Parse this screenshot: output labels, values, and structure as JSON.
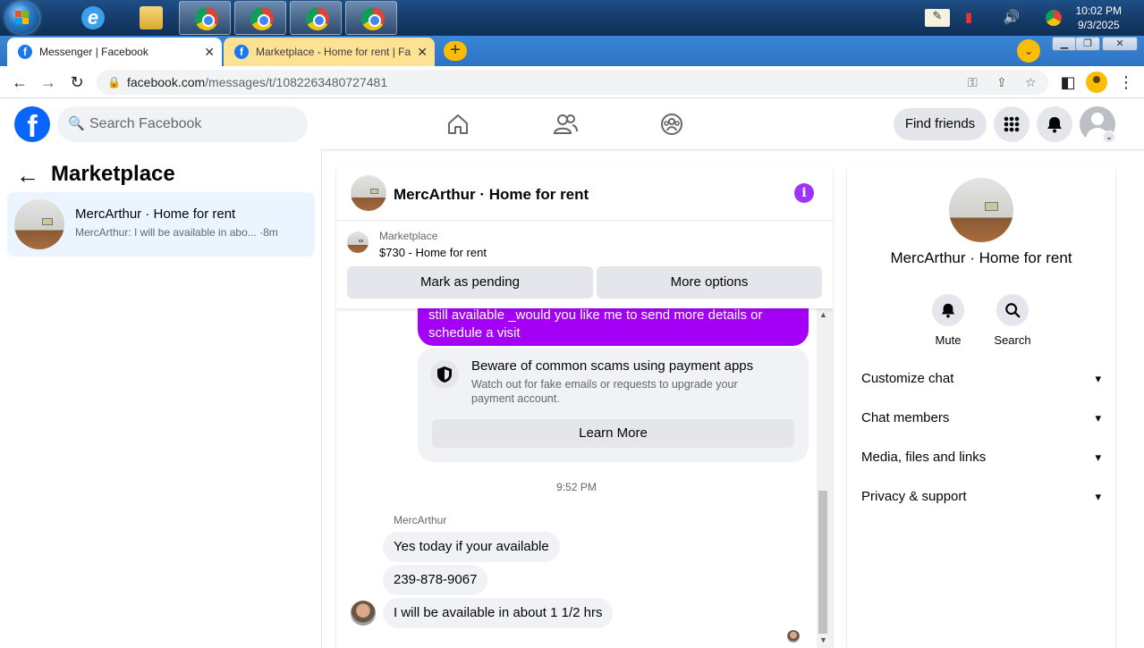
{
  "system": {
    "time": "10:02 PM",
    "date": "9/3/2025"
  },
  "browser": {
    "tabs": [
      {
        "label": "Messenger | Facebook"
      },
      {
        "label": "Marketplace - Home for rent | Fa"
      }
    ],
    "url_host": "facebook.com",
    "url_path": "/messages/t/1082263480727481"
  },
  "header": {
    "search_placeholder": "Search Facebook",
    "find_friends": "Find friends"
  },
  "sidebar": {
    "title": "Marketplace",
    "conversations": [
      {
        "name": "MercArthur · Home for rent",
        "last_message": "MercArthur: I will be available in abo...",
        "time": "·8m"
      }
    ]
  },
  "chat": {
    "title": "MercArthur · Home for rent",
    "listing": {
      "label": "Marketplace",
      "price_title": "$730 - Home for rent",
      "mark_pending": "Mark as pending",
      "more_options": "More options"
    },
    "outgoing_partial": "still available _would you like me to send more details or schedule a visit",
    "scam_warning": {
      "title": "Beware of common scams using payment apps",
      "body": "Watch out for fake emails or requests to upgrade your payment account.",
      "button": "Learn More"
    },
    "timestamp": "9:52 PM",
    "sender": "MercArthur",
    "messages": [
      "Yes today if your available",
      "239-878-9067",
      "I will be available in about 1 1/2 hrs"
    ]
  },
  "details": {
    "name": "MercArthur · Home for rent",
    "actions": [
      {
        "label": "Mute",
        "icon": "bell-icon"
      },
      {
        "label": "Search",
        "icon": "search-icon"
      }
    ],
    "sections": [
      "Customize chat",
      "Chat members",
      "Media, files and links",
      "Privacy & support"
    ]
  },
  "colors": {
    "brand": "#0866ff",
    "bubble_outgoing": "#a300f5",
    "selected_conversation": "#ebf5ff"
  }
}
